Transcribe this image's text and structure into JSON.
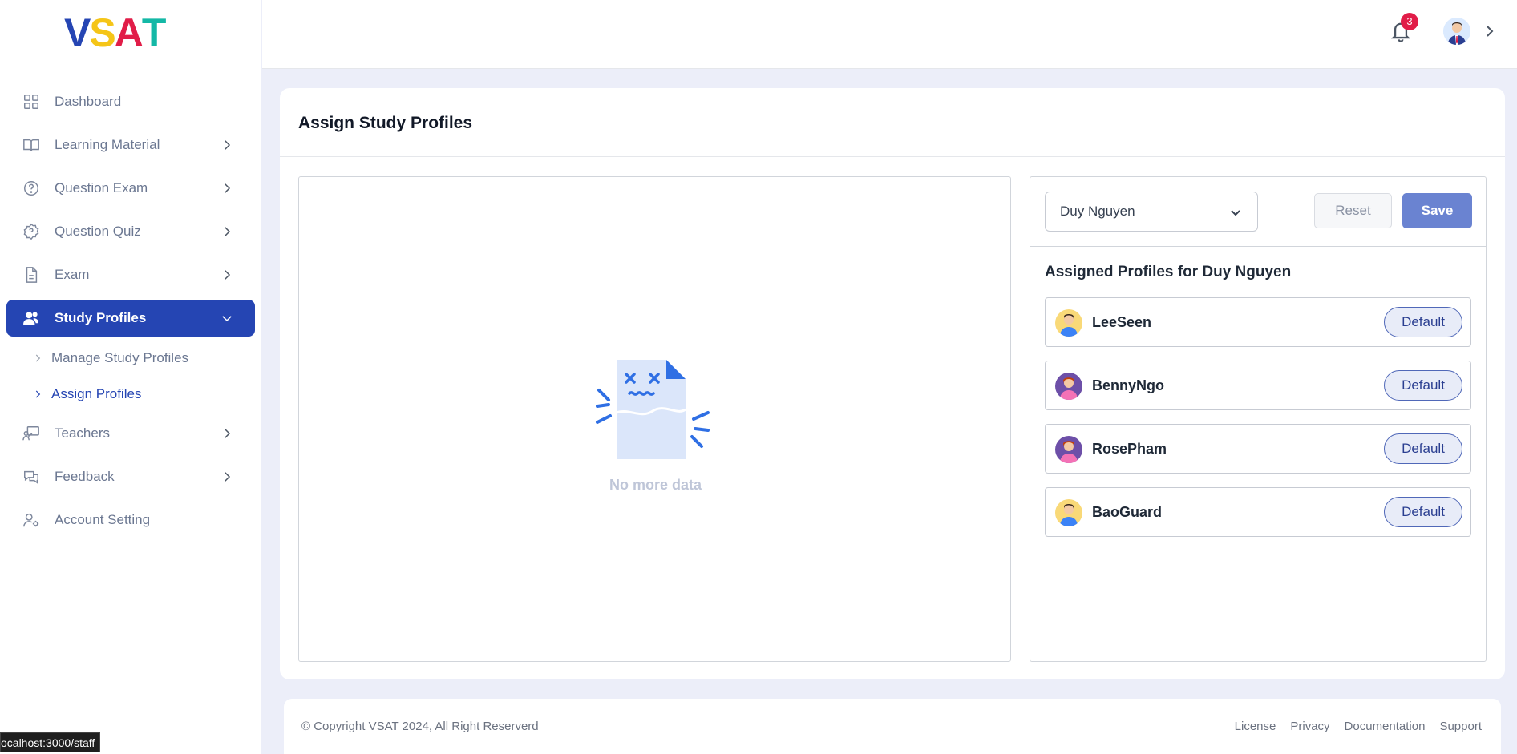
{
  "brand": {
    "letters": [
      "V",
      "S",
      "A",
      "T"
    ],
    "colors": [
      "#2545b3",
      "#f5c518",
      "#e11d48",
      "#14b8a6"
    ]
  },
  "sidebar": {
    "items": [
      {
        "label": "Dashboard",
        "icon": "grid-icon"
      },
      {
        "label": "Learning Material",
        "icon": "book-icon"
      },
      {
        "label": "Question Exam",
        "icon": "question-circle-icon"
      },
      {
        "label": "Question Quiz",
        "icon": "quiz-icon"
      },
      {
        "label": "Exam",
        "icon": "document-icon"
      },
      {
        "label": "Study Profiles",
        "icon": "users-icon"
      },
      {
        "label": "Teachers",
        "icon": "teacher-icon"
      },
      {
        "label": "Feedback",
        "icon": "chat-icon"
      },
      {
        "label": "Account Setting",
        "icon": "user-gear-icon"
      }
    ],
    "sub_items": [
      {
        "label": "Manage Study Profiles"
      },
      {
        "label": "Assign Profiles"
      }
    ]
  },
  "header": {
    "notification_count": "3"
  },
  "main": {
    "title": "Assign Study Profiles",
    "empty_text": "No more data",
    "selected_user": "Duy Nguyen",
    "reset_label": "Reset",
    "save_label": "Save",
    "assigned_title": "Assigned Profiles for Duy Nguyen",
    "profiles": [
      {
        "name": "LeeSeen",
        "button": "Default"
      },
      {
        "name": "BennyNgo",
        "button": "Default"
      },
      {
        "name": "RosePham",
        "button": "Default"
      },
      {
        "name": "BaoGuard",
        "button": "Default"
      }
    ]
  },
  "footer": {
    "copyright": "© Copyright VSAT 2024, All Right Reserverd",
    "links": [
      "License",
      "Privacy",
      "Documentation",
      "Support"
    ]
  },
  "status_bar": {
    "url": "ocalhost:3000/staff"
  }
}
